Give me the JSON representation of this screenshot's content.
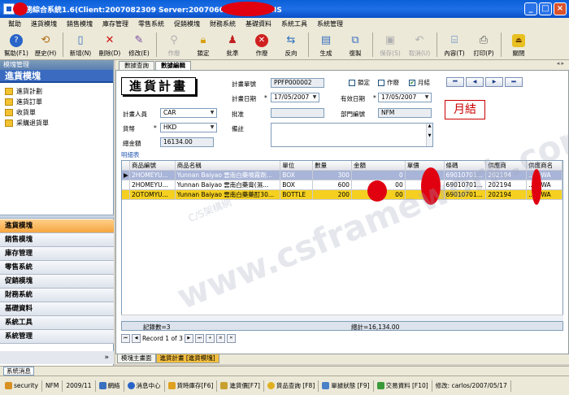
{
  "window": {
    "title": "業務綜合系統1.6(Client:2007082309  Server:2007060 1)                imited MIS",
    "buttons": [
      "_",
      "□",
      "×"
    ]
  },
  "menu": [
    "幫助",
    "進貨模塊",
    "銷售模塊",
    "庫存管理",
    "零售系統",
    "促銷模塊",
    "財務系統",
    "基礎資料",
    "系統工具",
    "系統管理"
  ],
  "toolbar": [
    {
      "label": "幫助(F1)",
      "icon": "help-icon",
      "enabled": true
    },
    {
      "label": "歷史(H)",
      "icon": "history-icon",
      "enabled": true
    },
    {
      "label": "新增(N)",
      "icon": "new-icon",
      "enabled": true
    },
    {
      "label": "刪除(D)",
      "icon": "delete-icon",
      "enabled": true
    },
    {
      "label": "修改(E)",
      "icon": "edit-icon",
      "enabled": true
    },
    {
      "label": "作廢",
      "icon": "void-icon",
      "enabled": false
    },
    {
      "label": "鎖定",
      "icon": "lock-icon",
      "enabled": true
    },
    {
      "label": "批準",
      "icon": "approve-icon",
      "enabled": true
    },
    {
      "label": "作廢",
      "icon": "cancel-icon",
      "enabled": true
    },
    {
      "label": "反向",
      "icon": "reverse-icon",
      "enabled": true
    },
    {
      "label": "生成",
      "icon": "generate-icon",
      "enabled": true
    },
    {
      "label": "復製",
      "icon": "copy-icon",
      "enabled": true
    },
    {
      "label": "保存(S)",
      "icon": "save-icon",
      "enabled": false
    },
    {
      "label": "取消(U)",
      "icon": "undo-icon",
      "enabled": false
    },
    {
      "label": "內容(T)",
      "icon": "content-icon",
      "enabled": true
    },
    {
      "label": "打印(P)",
      "icon": "print-icon",
      "enabled": true
    },
    {
      "label": "關閉",
      "icon": "close-door-icon",
      "enabled": true
    }
  ],
  "sidebar": {
    "title": "模塊管理",
    "header": "進貨模塊",
    "items": [
      "進貨計劃",
      "進貨訂單",
      "收貨單",
      "采購退貨單"
    ],
    "modules": [
      "進貨模塊",
      "銷售模塊",
      "庫存管理",
      "零售系統",
      "促銷模塊",
      "財務系統",
      "基礎資料",
      "系統工具",
      "系統管理"
    ],
    "more": "»"
  },
  "tabs": [
    "數據查詢",
    "數據編輯"
  ],
  "form": {
    "title": "進貨計畫",
    "plan_no_label": "計畫單號",
    "plan_no": "PPFP000002",
    "lock_label": "鎖定",
    "void_label": "作廢",
    "monthly_label": "月結",
    "plan_date_label": "計畫日期",
    "plan_date": "17/05/2007",
    "valid_date_label": "有效日期",
    "valid_date": "17/05/2007",
    "planner_label": "計畫人員",
    "planner": "CAR",
    "approve_label": "批准",
    "approve": "",
    "dept_label": "部門編號",
    "dept": "NFM",
    "currency_label": "貨幣",
    "currency": "HKD",
    "remark_label": "備註",
    "total_label": "總金額",
    "total": "16134.00",
    "required_mark": "*",
    "nav": [
      "⏮",
      "◀",
      "▶",
      "⏭"
    ],
    "monthly_stamp": "月結",
    "detail_label": "明細表"
  },
  "grid": {
    "columns": [
      "商品編號",
      "商品名稱",
      "單位",
      "數量",
      "金額",
      "單價",
      "條碼",
      "供應商",
      "供應商名"
    ],
    "rows": [
      [
        "2HOMEYU...",
        "Yunnan Baiyao 雲南白藥噴霧劑...",
        "BOX",
        "300",
        "0",
        "",
        "69010701...",
        "202194",
        "...G WA"
      ],
      [
        "2HOMEYU...",
        "Yunnan Baiyao 雲南白藥膏(濕...",
        "BOX",
        "600",
        "00",
        "",
        "69010701...",
        "202194",
        "...G WA"
      ],
      [
        "2OTOMYU...",
        "Yunnan Baiyao 雲南白藥藥酊30...",
        "BOTTLE",
        "200",
        "00",
        "",
        "69010701...",
        "202194",
        "...G WA"
      ]
    ],
    "row_marker": "▶",
    "footer_count": "記錄數=3",
    "footer_total": "總計=16,134.00",
    "pager": "Record 1 of 3"
  },
  "bottom_tabs": [
    "模塊主畫面",
    "進貨計畫 [進貨模塊]"
  ],
  "msg_tab": "系統消息",
  "status": [
    {
      "text": "security",
      "icon": "user-icon"
    },
    {
      "text": "NFM",
      "icon": ""
    },
    {
      "text": "2009/11",
      "icon": ""
    },
    {
      "text": "網絡",
      "icon": "network-icon"
    },
    {
      "text": "消息中心",
      "icon": "info-icon"
    },
    {
      "text": "貨時庫存[F6]",
      "icon": "stock-icon"
    },
    {
      "text": "進貨價[F7]",
      "icon": "price-icon"
    },
    {
      "text": "貨品查詢 [F8]",
      "icon": "query-icon"
    },
    {
      "text": "單據狀態 [F9]",
      "icon": "status-icon"
    },
    {
      "text": "交易資料 [F10]",
      "icon": "trade-icon"
    },
    {
      "text": "修改: carlos/2007/05/17",
      "icon": ""
    }
  ],
  "watermark": "www.csframework.com",
  "watermark_sub": "C/S架構網"
}
